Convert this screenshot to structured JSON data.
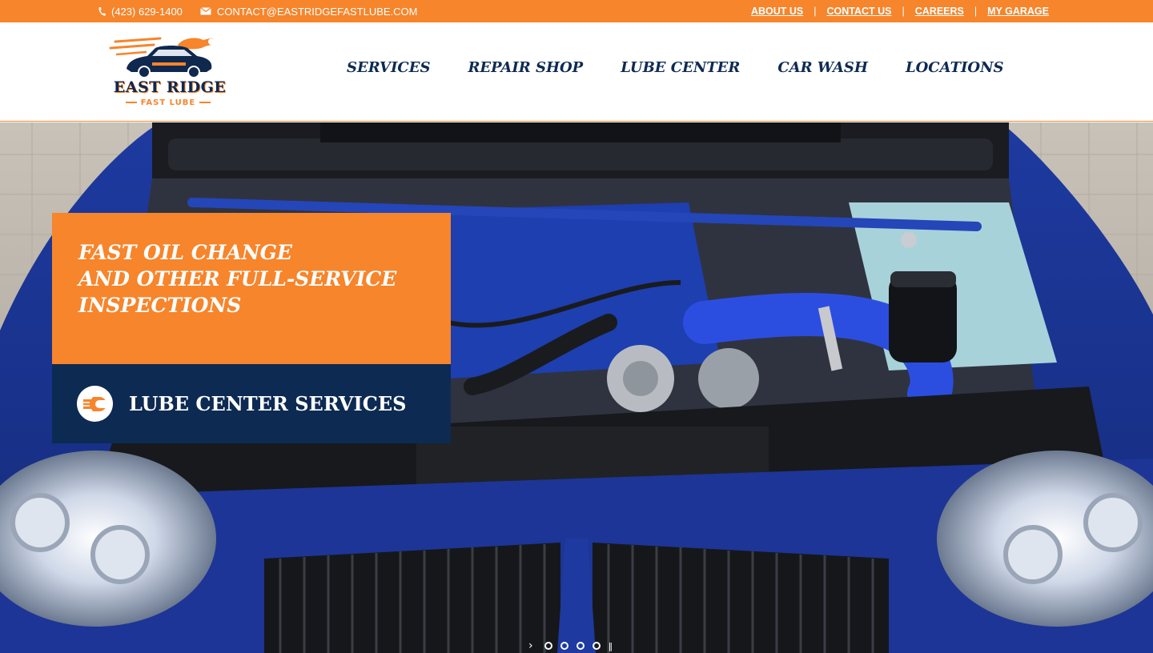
{
  "topbar": {
    "phone": "(423) 629-1400",
    "email": "CONTACT@EASTRIDGEFASTLUBE.COM",
    "links": [
      "ABOUT US",
      "CONTACT US",
      "CAREERS",
      "MY GARAGE"
    ],
    "separator": "|",
    "icons": [
      "phone-icon",
      "mail-icon"
    ]
  },
  "logo": {
    "name": "EAST RIDGE",
    "sub": "FAST LUBE"
  },
  "nav": {
    "items": [
      "SERVICES",
      "REPAIR SHOP",
      "LUBE CENTER",
      "CAR WASH",
      "LOCATIONS"
    ]
  },
  "hero": {
    "headline_lines": [
      "FAST OIL CHANGE",
      "AND OTHER FULL-SERVICE",
      "INSPECTIONS"
    ],
    "cta_label": "LUBE CENTER SERVICES",
    "cta_icon": "wrench-badge-icon",
    "slide_count": 4,
    "current_slide": 1
  },
  "colors": {
    "accent": "#f6852c",
    "navy": "#0d2a52",
    "white": "#ffffff"
  }
}
